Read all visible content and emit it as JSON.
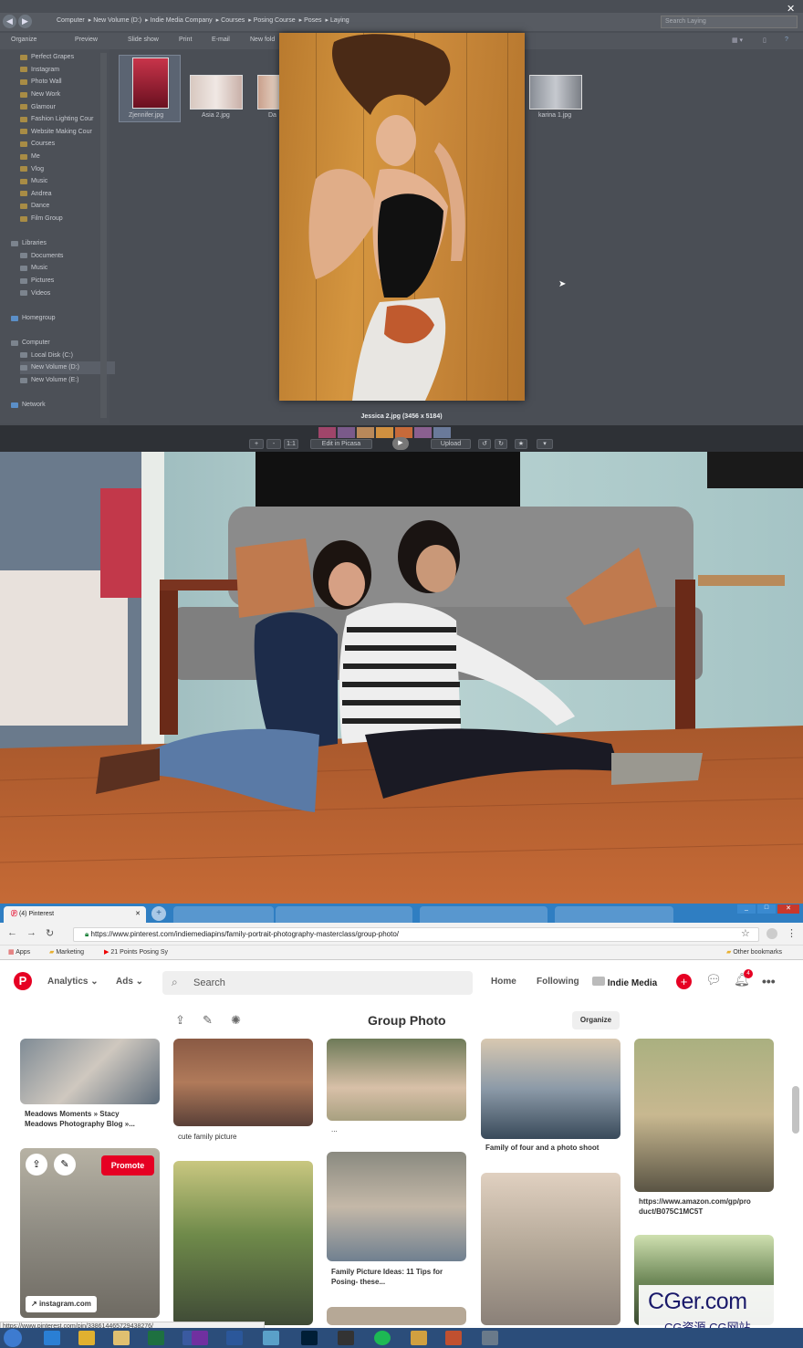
{
  "explorer": {
    "breadcrumbs": [
      "Computer",
      "New Volume (D:)",
      "Indie Media Company",
      "Courses",
      "Posing Course",
      "Poses",
      "Laying"
    ],
    "search_placeholder": "Search Laying",
    "commands": [
      "Organize",
      "Preview",
      "Slide show",
      "Print",
      "E-mail",
      "New fold"
    ],
    "folders": [
      "Perfect Grapes",
      "Instagram",
      "Photo Wall",
      "New Work",
      "Glamour",
      "Fashion Lighting Cour",
      "Website Making Cour",
      "Courses",
      "Me",
      "Vlog",
      "Music",
      "Andrea",
      "Dance",
      "Film Group"
    ],
    "libraries_label": "Libraries",
    "libraries": [
      "Documents",
      "Music",
      "Pictures",
      "Videos"
    ],
    "homegroup_label": "Homegroup",
    "computer_label": "Computer",
    "drives": [
      "Local Disk (C:)",
      "New Volume (D:)",
      "New Volume (E:)"
    ],
    "network_label": "Network",
    "files": [
      {
        "name": "Zjennifer.jpg"
      },
      {
        "name": "Asia 2.jpg"
      },
      {
        "name": "Da"
      },
      {
        "name": "karina 1.jpg"
      }
    ]
  },
  "picasa": {
    "caption": "Jessica 2.jpg (3456 x 5184)",
    "zoom_label": "1:1",
    "edit_label": "Edit in Picasa",
    "upload_label": "Upload",
    "close_glyph": "✕"
  },
  "chrome": {
    "tab_title": "(4) Pinterest",
    "url": "https://www.pinterest.com/indiemediapins/family-portrait-photography-masterclass/group-photo/",
    "bookmarks": [
      "Apps",
      "Marketing",
      "21 Points Posing Sy",
      "Other bookmarks"
    ],
    "status_url": "https://www.pinterest.com/pin/338614465729438276/"
  },
  "pinterest": {
    "nav": {
      "analytics": "Analytics",
      "ads": "Ads",
      "search": "Search",
      "home": "Home",
      "following": "Following",
      "user": "Indie Media",
      "notif_count": "4"
    },
    "board_title": "Group Photo",
    "organize_label": "Organize",
    "promote_label": "Promote",
    "source_label": "instagram.com",
    "captions": {
      "c1a": "Meadows Moments » Stacy",
      "c1b": "Meadows Photography Blog »...",
      "c2": "cute family picture",
      "c3": "...",
      "c4": "Family Picture Ideas: 11 Tips for",
      "c4b": "Posing- these...",
      "c5": "Family of four and a photo shoot",
      "c6a": "https://www.amazon.com/gp/pro",
      "c6b": "duct/B075C1MC5T"
    }
  },
  "watermark": {
    "line1": "CGer.com",
    "line2": "CG资源 CG网站"
  }
}
